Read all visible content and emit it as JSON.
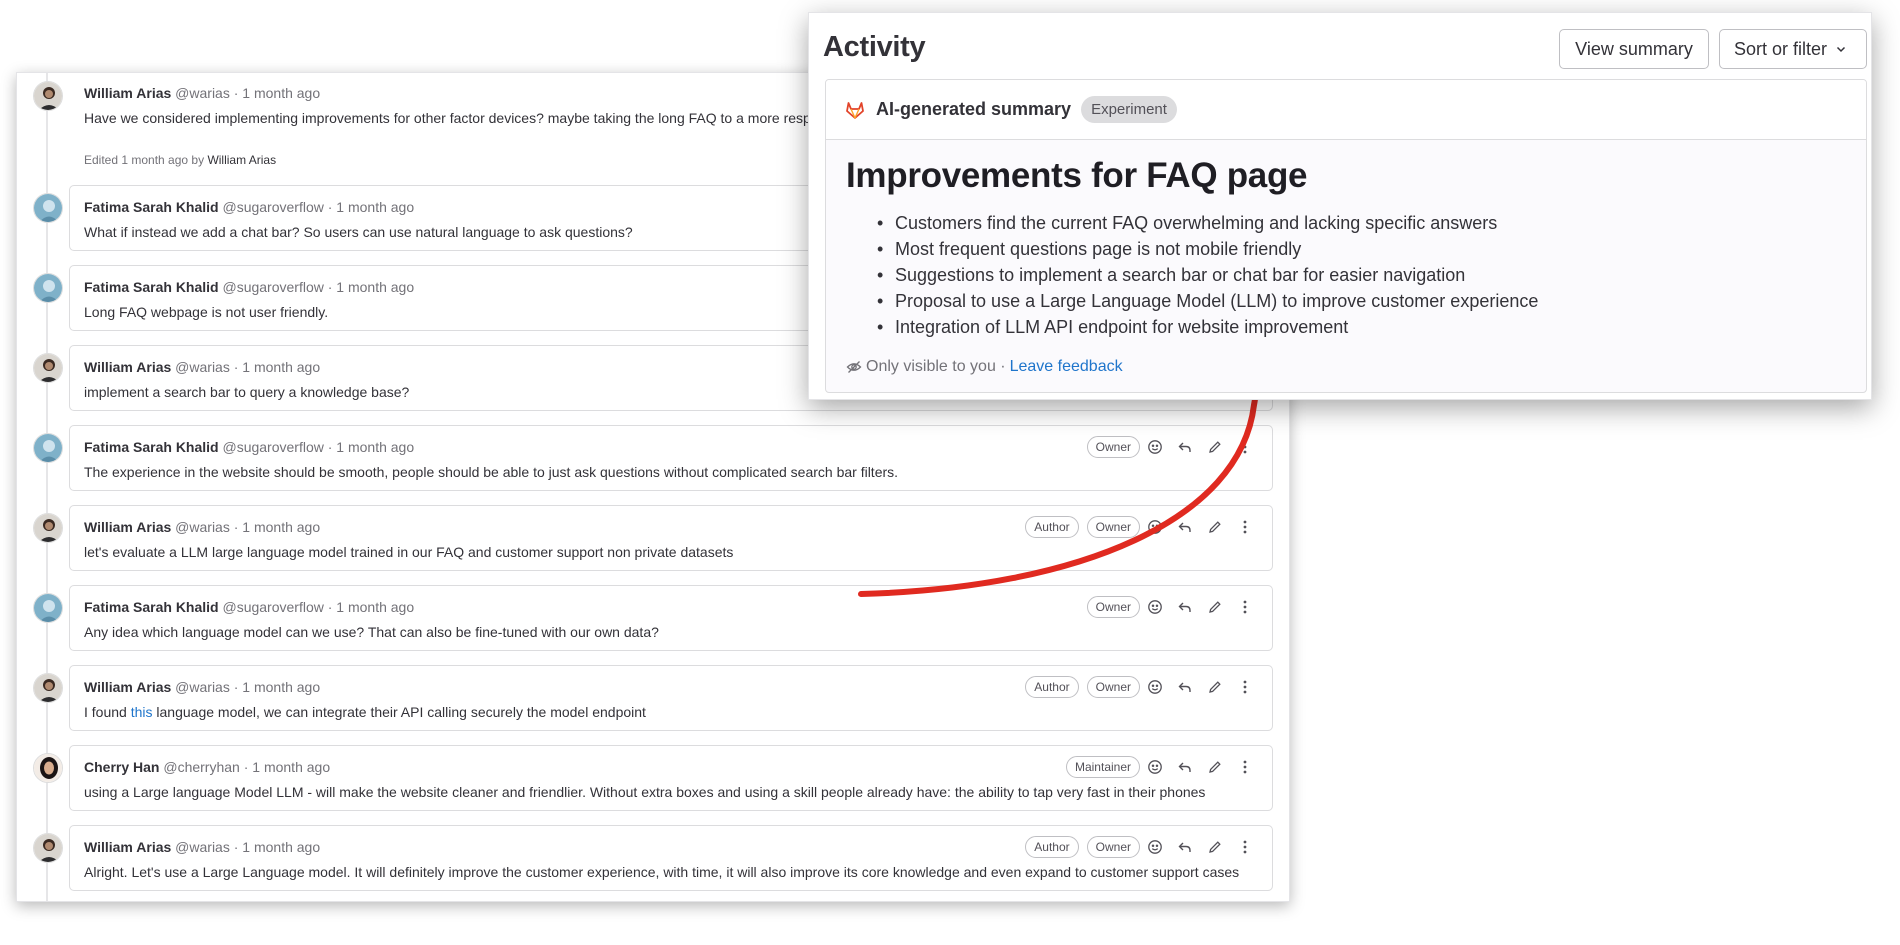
{
  "activity": {
    "title": "Activity",
    "view_summary_label": "View summary",
    "sort_filter_label": "Sort or filter",
    "summary_label": "AI-generated summary",
    "experiment_badge": "Experiment",
    "summary_title": "Improvements for FAQ page",
    "bullets": [
      "Customers find the current FAQ overwhelming and lacking specific answers",
      "Most frequent questions page is not mobile friendly",
      "Suggestions to implement a search bar or chat bar for easier navigation",
      "Proposal to use a Large Language Model (LLM) to improve customer experience",
      "Integration of LLM API endpoint for website improvement"
    ],
    "visibility_text": "Only visible to you ·",
    "feedback_link": "Leave feedback"
  },
  "comments": [
    {
      "author": "William Arias",
      "meta": "@warias · 1 month ago",
      "body": "Have we considered implementing improvements for other factor devices? maybe taking the long FAQ to a more respo",
      "edited_prefix": "Edited 1 month ago by",
      "edited_by": "William Arias"
    },
    {
      "author": "Fatima Sarah Khalid",
      "meta": "@sugaroverflow · 1 month ago",
      "body": "What if instead we add a chat bar? So users can use natural language to ask questions?"
    },
    {
      "author": "Fatima Sarah Khalid",
      "meta": "@sugaroverflow · 1 month ago",
      "body": "Long FAQ webpage is not user friendly."
    },
    {
      "author": "William Arias",
      "meta": "@warias · 1 month ago",
      "body": "implement a search bar to query a knowledge base?"
    },
    {
      "author": "Fatima Sarah Khalid",
      "meta": "@sugaroverflow · 1 month ago",
      "body": "The experience in the website should be smooth, people should be able to just ask questions without complicated search bar filters.",
      "badges": [
        "Owner"
      ]
    },
    {
      "author": "William Arias",
      "meta": "@warias · 1 month ago",
      "body": "let's evaluate a LLM large language model trained in our FAQ and customer support non private datasets",
      "badges": [
        "Author",
        "Owner"
      ]
    },
    {
      "author": "Fatima Sarah Khalid",
      "meta": "@sugaroverflow · 1 month ago",
      "body": "Any idea which language model can we use? That can also be fine-tuned with our own data?",
      "badges": [
        "Owner"
      ]
    },
    {
      "author": "William Arias",
      "meta": "@warias · 1 month ago",
      "body_pre": "I found",
      "body_link": "this",
      "body_post": "language model, we can integrate their API calling securely the model endpoint",
      "badges": [
        "Author",
        "Owner"
      ]
    },
    {
      "author": "Cherry Han",
      "meta": "@cherryhan · 1 month ago",
      "body": "using a Large language Model LLM - will make the website cleaner and friendlier. Without extra boxes and using a skill people already have: the ability to tap very fast in their phones",
      "badges": [
        "Maintainer"
      ]
    },
    {
      "author": "William Arias",
      "meta": "@warias · 1 month ago",
      "body": "Alright. Let's use a Large Language model. It will definitely improve the customer experience, with time, it will also improve its core knowledge and even expand to customer support cases",
      "badges": [
        "Author",
        "Owner"
      ]
    }
  ],
  "colors": {
    "arrow": "#e02a20",
    "link": "#1f75cb",
    "tanuki": "#e24329"
  }
}
